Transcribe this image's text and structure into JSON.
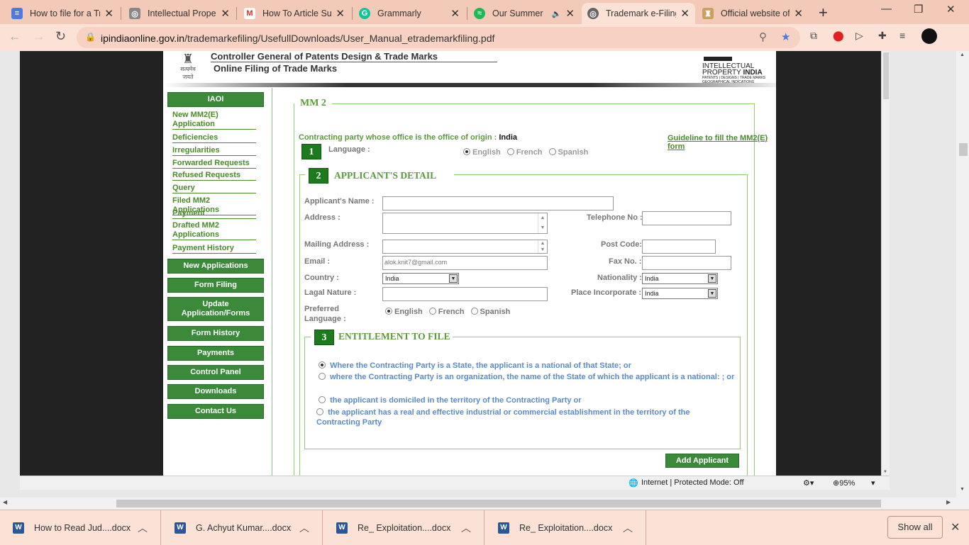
{
  "tabs": [
    {
      "title": "How to file for a Tr",
      "fav_color": "#4a7be0",
      "fav_glyph": "≡"
    },
    {
      "title": "Intellectual Proper",
      "fav_color": "#888888",
      "fav_glyph": "◎"
    },
    {
      "title": "How To Article Sub",
      "fav_color": "#ffffff",
      "fav_glyph": "M"
    },
    {
      "title": "Grammarly",
      "fav_color": "#15c39a",
      "fav_glyph": "G"
    },
    {
      "title": "Our Summer",
      "fav_color": "#1db954",
      "fav_glyph": "≈"
    },
    {
      "title": "Trademark e-Filing",
      "fav_color": "#666666",
      "fav_glyph": "◎"
    },
    {
      "title": "Official website of",
      "fav_color": "#c8a060",
      "fav_glyph": "♜"
    }
  ],
  "address": {
    "host": "ipindiaonline.gov.in",
    "path": "/trademarkefiling/UsefullDownloads/User_Manual_etrademarkfiling.pdf"
  },
  "header": {
    "line1": "Controller General of Patents Design & Trade Marks",
    "line2": "Online Filing of Trade Marks",
    "emblem_text": "सत्यमेव जयते",
    "ip_line1": "INTELLECTUAL",
    "ip_line2a": "PROPERTY ",
    "ip_line2b": "INDIA",
    "ip_line3": "PATENTS | DESIGNS | TRADE MARKS",
    "ip_line4": "GEOGRAPHICAL INDICATIONS"
  },
  "sidebar": {
    "iaoi": "IAOI",
    "links": [
      "New MM2(E) Application",
      "Deficiencies",
      "Irregularities",
      "Forwarded Requests",
      "Refused Requests",
      "Query",
      "Filed MM2 Applications",
      "Payment",
      "Drafted MM2 Applications",
      "Payment History"
    ],
    "buttons": [
      "New Applications",
      "Form Filing",
      "Update Application/Forms",
      "Form History",
      "Payments",
      "Control Panel",
      "Downloads",
      "Contact Us"
    ]
  },
  "form": {
    "legend": "MM 2",
    "guideline": "Guideline to fill the MM2(E) form",
    "contracting_label": "Contracting party whose office is the office of origin : ",
    "contracting_value": "India",
    "s1_num": "1",
    "language_label": "Language :",
    "languages": [
      "English",
      "French",
      "Spanish"
    ],
    "s2_num": "2",
    "s2_title": "APPLICANT'S DETAIL",
    "applicant_name_label": "Applicant's Name :",
    "address_label": "Address :",
    "telephone_label": "Telephone No :",
    "mailing_label": "Mailing Address :",
    "postcode_label": "Post Code:",
    "email_label": "Email :",
    "email_value": "alok.knit7@gmail.com",
    "fax_label": "Fax No. :",
    "country_label": "Country :",
    "country_value": "India",
    "nationality_label": "Nationality :",
    "nationality_value": "India",
    "legal_label": "Lagal Nature :",
    "place_label": "Place Incorporate :",
    "place_value": "India",
    "pref_lang_label": "Preferred Language :",
    "s3_num": "3",
    "s3_title": "ENTITLEMENT TO FILE",
    "ent1": "Where the Contracting Party is a State, the applicant is a national of that State; or",
    "ent2": "where the Contracting Party is an organization, the name of the State of which the applicant is a national: ; or",
    "ent3": "the applicant is domiciled in the territory of the Contracting Party or",
    "ent4": "the applicant has a real and effective industrial or commercial establishment in the territory of the Contracting Party",
    "add_applicant": "Add Applicant"
  },
  "status": {
    "zone": "Internet | Protected Mode: Off",
    "zoom": "95%"
  },
  "downloads": [
    "How to Read Jud....docx",
    "G. Achyut Kumar....docx",
    "Re_ Exploitation....docx",
    "Re_ Exploitation....docx"
  ],
  "show_all": "Show all"
}
